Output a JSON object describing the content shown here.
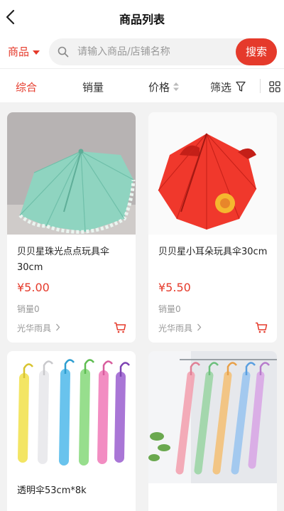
{
  "header": {
    "title": "商品列表"
  },
  "search": {
    "category": "商品",
    "placeholder": "请输入商品/店铺名称",
    "button": "搜索"
  },
  "sort": {
    "tabs": [
      "综合",
      "销量",
      "价格",
      "筛选"
    ],
    "active": "综合"
  },
  "products": [
    {
      "name": "贝贝星珠光点点玩具伞30cm",
      "price": "¥5.00",
      "sales": "销量0",
      "shop": "光华雨具"
    },
    {
      "name": "贝贝星小耳朵玩具伞30cm",
      "price": "¥5.50",
      "sales": "销量0",
      "shop": "光华雨具"
    },
    {
      "name": "透明伞53cm*8k"
    },
    {
      "name": ""
    }
  ],
  "colors": {
    "accent": "#e53a2b"
  }
}
